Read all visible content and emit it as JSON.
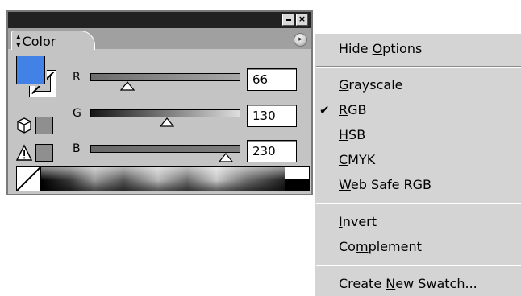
{
  "panel": {
    "tab_label": "Color",
    "title_buttons": {
      "minimize": "minimize-icon",
      "close": "×"
    },
    "options_button": "▸",
    "fill_color": "#4282e6",
    "channels": [
      {
        "label": "R",
        "value": "66"
      },
      {
        "label": "G",
        "value": "130"
      },
      {
        "label": "B",
        "value": "230"
      }
    ]
  },
  "menu": {
    "items": [
      {
        "label": "Hide Options",
        "accel": "O",
        "checked": false
      },
      {
        "label": "Grayscale",
        "accel": "G",
        "checked": false
      },
      {
        "label": "RGB",
        "accel": "R",
        "checked": true
      },
      {
        "label": "HSB",
        "accel": "H",
        "checked": false
      },
      {
        "label": "CMYK",
        "accel": "C",
        "checked": false
      },
      {
        "label": "Web Safe RGB",
        "accel": "W",
        "checked": false
      },
      {
        "label": "Invert",
        "accel": "I",
        "checked": false
      },
      {
        "label": "Complement",
        "accel": "m",
        "checked": false
      },
      {
        "label": "Create New Swatch...",
        "accel": "N",
        "checked": false
      }
    ]
  }
}
